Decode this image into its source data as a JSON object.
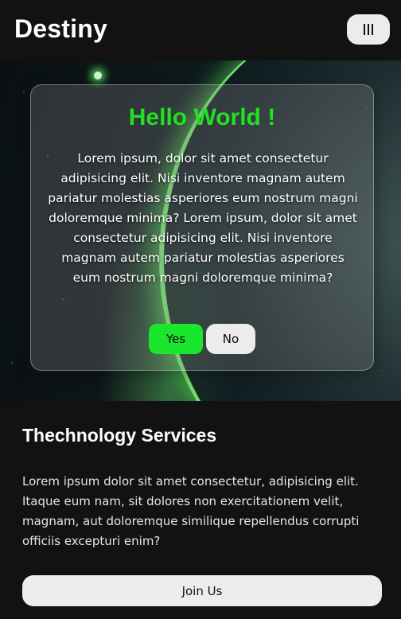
{
  "header": {
    "brand": "Destiny",
    "menu_icon": "hamburger-menu-icon"
  },
  "hero": {
    "title": "Hello World !",
    "text": "Lorem ipsum, dolor sit amet consectetur adipisicing elit. Nisi inventore magnam autem pariatur molestias asperiores eum nostrum magni doloremque minima? Lorem ipsum, dolor sit amet consectetur adipisicing elit. Nisi inventore magnam autem pariatur molestias asperiores eum nostrum magni doloremque minima?",
    "yes_label": "Yes",
    "no_label": "No"
  },
  "services": {
    "title": "Thechnology Services",
    "text": "Lorem ipsum dolor sit amet consectetur, adipisicing elit. Itaque eum nam, sit dolores non exercitationem velit, magnam, aut doloremque similique repellendus corrupti officiis excepturi enim?",
    "join_label": "Join Us"
  },
  "colors": {
    "accent_green": "#19e62c",
    "title_green": "#22e022",
    "background": "#121212"
  }
}
